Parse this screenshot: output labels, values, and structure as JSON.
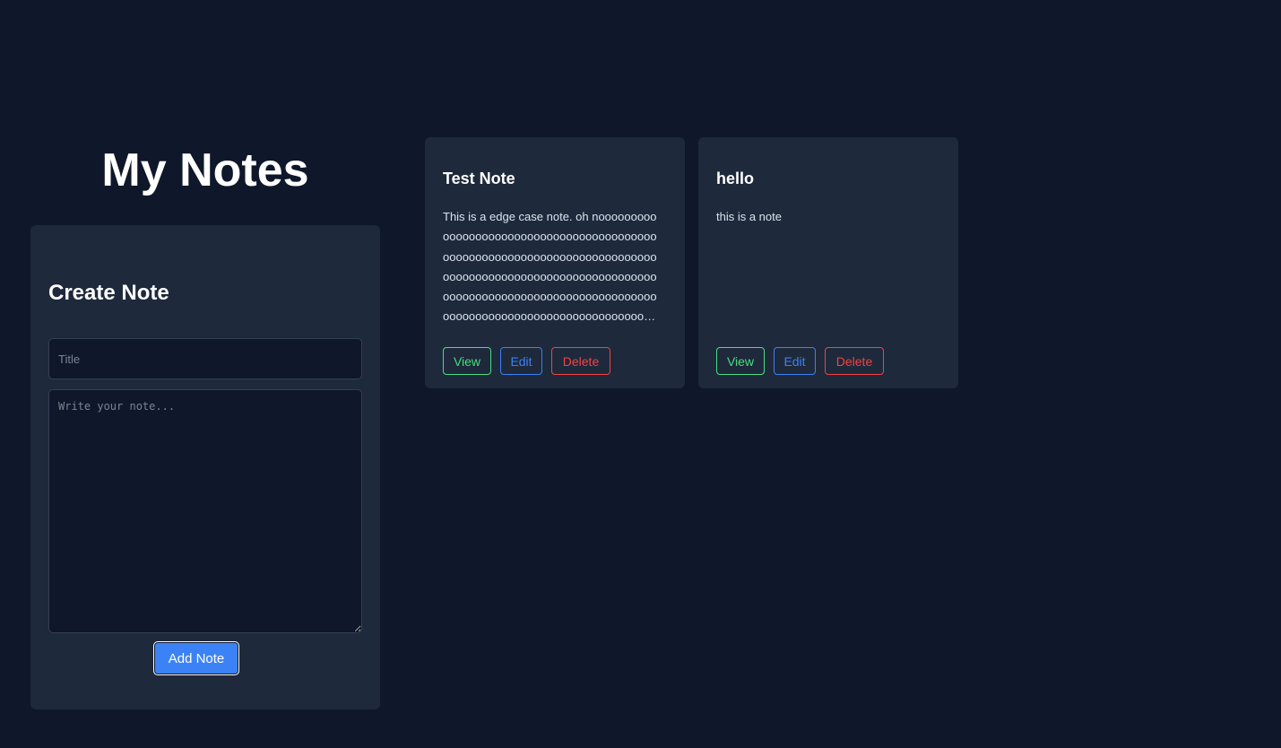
{
  "header": {
    "title": "My Notes"
  },
  "create_form": {
    "heading": "Create Note",
    "title_placeholder": "Title",
    "title_value": "",
    "body_placeholder": "Write your note...",
    "body_value": "",
    "submit_label": "Add Note"
  },
  "notes": [
    {
      "title": "Test Note",
      "body": "This is a edge case note. oh nooooooooooooooooooooooooooooooooooooooooooooooooooooooooooooooooooooooooooooooooooooooooooooooooooooooooooooooooooooooooooooooooooooooooooooooooooooooooooooooooooooooooooooooooooooooooooooooooooooooooooooooooooooooooooooooooooooooooooooooooooooooooooooooooooooooooo",
      "view_label": "View",
      "edit_label": "Edit",
      "delete_label": "Delete"
    },
    {
      "title": "hello",
      "body": "this is a note",
      "view_label": "View",
      "edit_label": "Edit",
      "delete_label": "Delete"
    }
  ],
  "colors": {
    "background": "#0f172a",
    "panel": "#1e293b",
    "primary": "#3b82f6",
    "view": "#4ade80",
    "delete": "#ef4444"
  }
}
